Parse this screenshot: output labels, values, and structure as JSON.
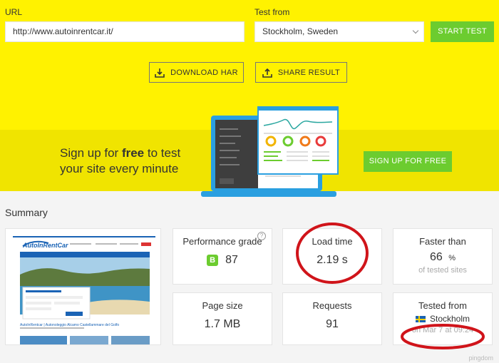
{
  "form": {
    "url_label": "URL",
    "url_value": "http://www.autoinrentcar.it/",
    "test_from_label": "Test from",
    "test_from_value": "Stockholm, Sweden",
    "start_test": "START TEST"
  },
  "actions": {
    "download_har": "DOWNLOAD HAR",
    "share_result": "SHARE RESULT"
  },
  "promo": {
    "line1_pre": "Sign up for ",
    "line1_bold": "free",
    "line1_post": " to test",
    "line2": "your site every minute",
    "signup_button": "SIGN UP FOR FREE"
  },
  "summary": {
    "title": "Summary",
    "performance_grade": {
      "label": "Performance grade",
      "grade": "B",
      "score": "87",
      "help": "?"
    },
    "load_time": {
      "label": "Load time",
      "value": "2.19 s"
    },
    "faster_than": {
      "label": "Faster than",
      "value": "66",
      "unit": "%",
      "sub": "of tested sites"
    },
    "page_size": {
      "label": "Page size",
      "value": "1.7 MB"
    },
    "requests": {
      "label": "Requests",
      "value": "91"
    },
    "tested_from": {
      "label": "Tested from",
      "location": "Stockholm",
      "date": "on Mar 7 at 09:24"
    }
  },
  "thumbnail": {
    "logo": "AutoInRentCar",
    "caption": "AutoInRentcar | Autonoleggio Alcamo Castellammare del Golfo"
  },
  "watermark": "pingdom",
  "colors": {
    "hero": "#fff200",
    "accent": "#6ccc2f",
    "annotation": "#d0141a"
  }
}
